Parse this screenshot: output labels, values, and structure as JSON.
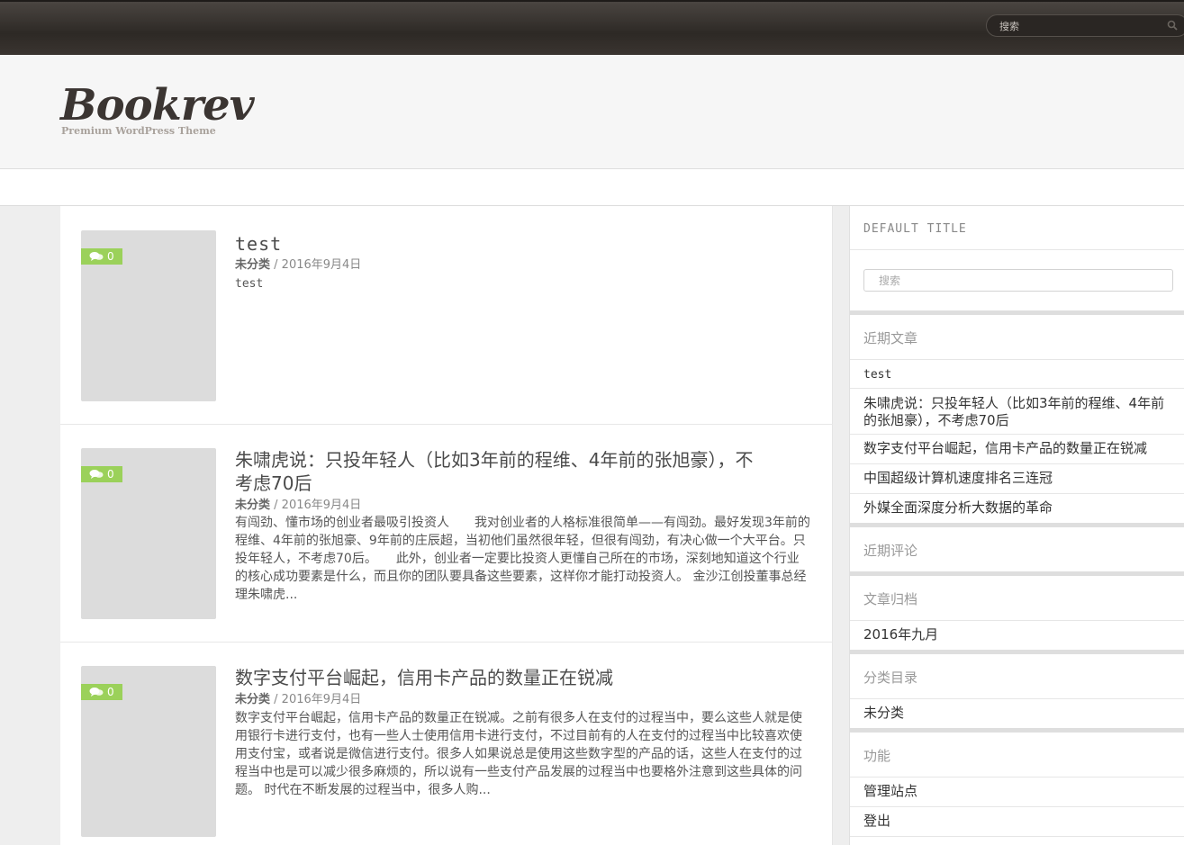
{
  "topbar": {
    "search_placeholder": "搜索"
  },
  "header": {
    "logo": "Bookrev",
    "tagline": "Premium WordPress Theme"
  },
  "posts": [
    {
      "title": "test",
      "comments": "0",
      "category": "未分类",
      "separator": " / ",
      "date": "2016年9月4日",
      "excerpt": "test"
    },
    {
      "title": "朱啸虎说：只投年轻人（比如3年前的程维、4年前的张旭豪），不考虑70后",
      "comments": "0",
      "category": "未分类",
      "separator": " / ",
      "date": "2016年9月4日",
      "excerpt": "有闯劲、懂市场的创业者最吸引投资人　　我对创业者的人格标准很简单——有闯劲。最好发现3年前的程维、4年前的张旭豪、9年前的庄辰超，当初他们虽然很年轻，但很有闯劲，有决心做一个大平台。只投年轻人，不考虑70后。　　此外，创业者一定要比投资人更懂自己所在的市场，深刻地知道这个行业的核心成功要素是什么，而且你的团队要具备这些要素，这样你才能打动投资人。 金沙江创投董事总经理朱啸虎..."
    },
    {
      "title": "数字支付平台崛起，信用卡产品的数量正在锐减",
      "comments": "0",
      "category": "未分类",
      "separator": " / ",
      "date": "2016年9月4日",
      "excerpt": "数字支付平台崛起，信用卡产品的数量正在锐减。之前有很多人在支付的过程当中，要么这些人就是使用银行卡进行支付，也有一些人士使用信用卡进行支付，不过目前有的人在支付的过程当中比较喜欢使用支付宝，或者说是微信进行支付。很多人如果说总是使用这些数字型的产品的话，这些人在支付的过程当中也是可以减少很多麻烦的，所以说有一些支付产品发展的过程当中也要格外注意到这些具体的问题。 时代在不断发展的过程当中，很多人购..."
    }
  ],
  "sidebar": {
    "default_title": "DEFAULT TITLE",
    "search_placeholder": "搜索",
    "recent_posts": {
      "title": "近期文章",
      "items": [
        "test",
        "朱啸虎说：只投年轻人（比如3年前的程维、4年前的张旭豪），不考虑70后",
        "数字支付平台崛起，信用卡产品的数量正在锐减",
        "中国超级计算机速度排名三连冠",
        "外媒全面深度分析大数据的革命"
      ]
    },
    "recent_comments": {
      "title": "近期评论"
    },
    "archives": {
      "title": "文章归档",
      "items": [
        "2016年九月"
      ]
    },
    "categories": {
      "title": "分类目录",
      "items": [
        "未分类"
      ]
    },
    "meta": {
      "title": "功能",
      "items": [
        "管理站点",
        "登出"
      ]
    }
  },
  "colors": {
    "accent_green": "#9bd15a",
    "topbar_dark": "#2d2925",
    "logo_color": "#3b3532"
  }
}
